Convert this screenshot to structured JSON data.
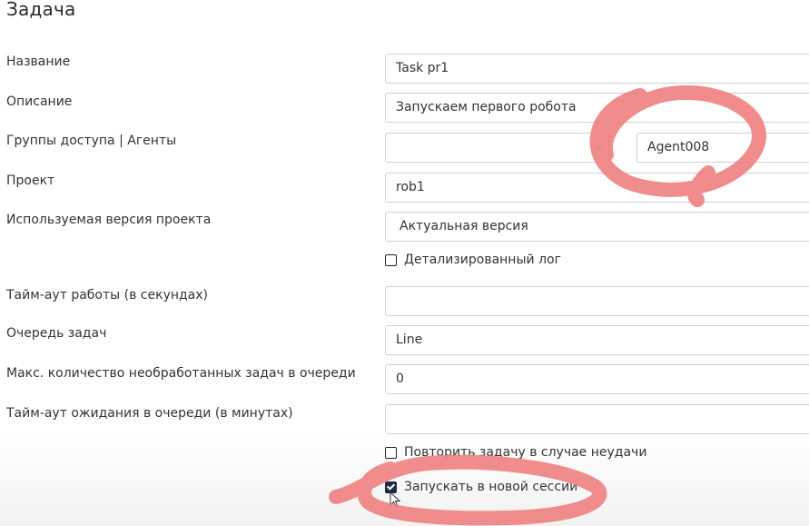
{
  "page_title": "Задача",
  "fields": {
    "name": {
      "label": "Название",
      "value": "Task pr1"
    },
    "description": {
      "label": "Описание",
      "value": "Запускаем первого робота"
    },
    "access_groups": {
      "label": "Группы доступа | Агенты",
      "group_value": "",
      "agent_value": "Agent008"
    },
    "project": {
      "label": "Проект",
      "value": "rob1"
    },
    "project_version": {
      "label": "Используемая версия проекта",
      "value": "Актуальная версия"
    },
    "timeout": {
      "label": "Тайм-аут работы (в секундах)",
      "value": ""
    },
    "queue": {
      "label": "Очередь задач",
      "value": "Line"
    },
    "max_unprocessed": {
      "label": "Макс. количество необработанных задач в очереди",
      "value": "0"
    },
    "queue_wait_timeout": {
      "label": "Тайм-аут ожидания в очереди (в минутах)",
      "value": ""
    }
  },
  "checkboxes": {
    "detailed_log": {
      "label": "Детализированный лог",
      "checked": false
    },
    "retry_on_failure": {
      "label": "Повторить задачу в случае неудачи",
      "checked": false
    },
    "new_session": {
      "label": "Запускать в новой сессии",
      "checked": true
    }
  },
  "annotation_color": "#f08080"
}
